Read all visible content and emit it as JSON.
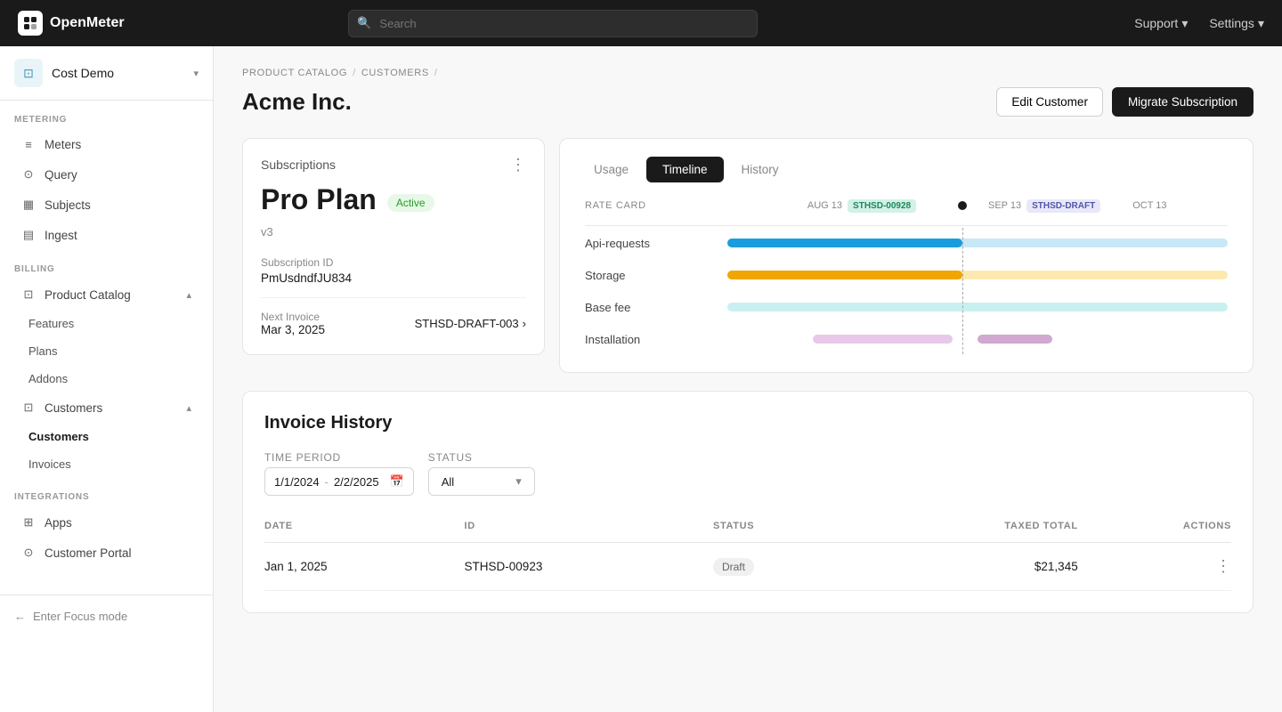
{
  "app": {
    "name": "OpenMeter"
  },
  "topnav": {
    "search_placeholder": "Search",
    "support_label": "Support",
    "settings_label": "Settings"
  },
  "sidebar": {
    "org_name": "Cost Demo",
    "sections": {
      "metering": {
        "label": "METERING",
        "items": [
          {
            "id": "meters",
            "label": "Meters",
            "icon": "≡"
          },
          {
            "id": "query",
            "label": "Query",
            "icon": "⊙"
          },
          {
            "id": "subjects",
            "label": "Subjects",
            "icon": "▦"
          },
          {
            "id": "ingest",
            "label": "Ingest",
            "icon": "▤"
          }
        ]
      },
      "billing": {
        "label": "BILLING",
        "items": [
          {
            "id": "product-catalog",
            "label": "Product Catalog",
            "icon": "⊡"
          }
        ],
        "subitems": [
          {
            "id": "features",
            "label": "Features"
          },
          {
            "id": "plans",
            "label": "Plans"
          },
          {
            "id": "addons",
            "label": "Addons"
          }
        ],
        "customers_item": {
          "id": "customers",
          "label": "Customers",
          "icon": "⊡"
        },
        "customers_sub": [
          {
            "id": "customers-sub",
            "label": "Customers"
          },
          {
            "id": "invoices",
            "label": "Invoices"
          }
        ]
      },
      "integrations": {
        "label": "INTEGRATIONS",
        "items": [
          {
            "id": "apps",
            "label": "Apps",
            "icon": "⊞"
          },
          {
            "id": "customer-portal",
            "label": "Customer Portal",
            "icon": "⊙"
          }
        ]
      }
    },
    "focus_mode": "Enter Focus mode"
  },
  "breadcrumb": {
    "items": [
      "PRODUCT CATALOG",
      "CUSTOMERS",
      ""
    ]
  },
  "page": {
    "title": "Acme Inc.",
    "edit_btn": "Edit Customer",
    "migrate_btn": "Migrate Subscription"
  },
  "subscription": {
    "section_title": "Subscriptions",
    "plan_name": "Pro Plan",
    "version": "v3",
    "status": "Active",
    "id_label": "Subscription ID",
    "id_value": "PmUsdndfJU834",
    "next_invoice_label": "Next Invoice",
    "next_invoice_date": "Mar 3, 2025",
    "next_invoice_id": "STHSD-DRAFT-003"
  },
  "timeline": {
    "tabs": [
      "Usage",
      "Timeline",
      "History"
    ],
    "active_tab": "Timeline",
    "rate_card_label": "RATE CARD",
    "dates": [
      {
        "label": "AUG 13",
        "badge": "STHSD-00928",
        "badge_type": "green"
      },
      {
        "label": "SEP 13",
        "badge": "STHSD-DRAFT",
        "badge_type": "purple"
      },
      {
        "label": "OCT 13",
        "badge": ""
      }
    ],
    "rows": [
      {
        "label": "Api-requests",
        "type": "blue"
      },
      {
        "label": "Storage",
        "type": "orange"
      },
      {
        "label": "Base fee",
        "type": "teal"
      },
      {
        "label": "Installation",
        "type": "pink"
      }
    ]
  },
  "invoice_history": {
    "title": "Invoice History",
    "filters": {
      "period_label": "TIME PERIOD",
      "from": "1/1/2024",
      "to": "2/2/2025",
      "status_label": "STATUS",
      "status_value": "All"
    },
    "table": {
      "headers": [
        "DATE",
        "ID",
        "STATUS",
        "TAXED TOTAL",
        "ACTIONS"
      ],
      "rows": [
        {
          "date": "Jan 1, 2025",
          "id": "STHSD-00923",
          "status": "Draft",
          "total": "$21,345"
        }
      ]
    }
  }
}
